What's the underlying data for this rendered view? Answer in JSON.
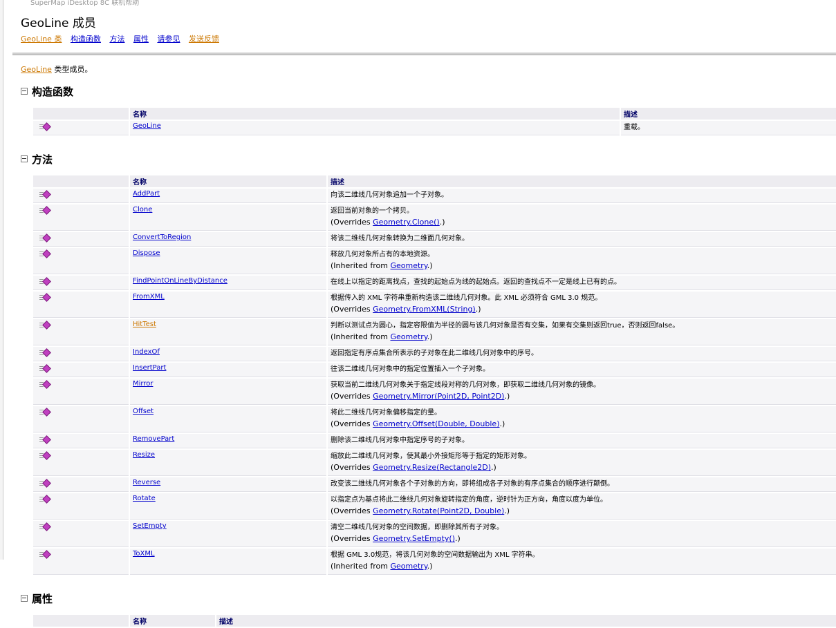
{
  "running_title": "SuperMap iDesktop 8C 联机帮助",
  "page_title": "GeoLine 成员",
  "nav": [
    {
      "label": "GeoLine 类",
      "style": "orange"
    },
    {
      "label": "构造函数",
      "style": "blue"
    },
    {
      "label": "方法",
      "style": "blue"
    },
    {
      "label": "属性",
      "style": "blue"
    },
    {
      "label": "请参见",
      "style": "blue"
    },
    {
      "label": "发送反馈",
      "style": "orange"
    }
  ],
  "intro": {
    "link": "GeoLine",
    "text": " 类型成员。"
  },
  "constructors": {
    "heading": "构造函数",
    "col_name": "名称",
    "col_desc": "描述",
    "rows": [
      {
        "icon": "method-icon",
        "name": "GeoLine",
        "desc": "重载。"
      }
    ]
  },
  "methods": {
    "heading": "方法",
    "col_name": "名称",
    "col_desc": "描述",
    "rows": [
      {
        "name": "AddPart",
        "desc": "向该二维线几何对象追加一个子对象。",
        "sub_prefix": "",
        "sub_link": "",
        "sub_suffix": ""
      },
      {
        "name": "Clone",
        "desc": "返回当前对象的一个拷贝。",
        "sub_prefix": "(Overrides ",
        "sub_link": "Geometry.Clone()",
        "sub_suffix": ".)"
      },
      {
        "name": "ConvertToRegion",
        "desc": "将该二维线几何对象转换为二维面几何对象。",
        "sub_prefix": "",
        "sub_link": "",
        "sub_suffix": ""
      },
      {
        "name": "Dispose",
        "desc": "释放几何对象所占有的本地资源。",
        "sub_prefix": "(Inherited from ",
        "sub_link": "Geometry",
        "sub_suffix": ".)"
      },
      {
        "name": "FindPointOnLineByDistance",
        "desc": "在线上以指定的距离找点，查找的起始点为线的起始点。返回的查找点不一定是线上已有的点。",
        "sub_prefix": "",
        "sub_link": "",
        "sub_suffix": ""
      },
      {
        "name": "FromXML",
        "desc": "根据传入的 XML 字符串重新构造该二维线几何对象。此 XML 必须符合 GML 3.0 规范。",
        "sub_prefix": "(Overrides ",
        "sub_link": "Geometry.FromXML(String)",
        "sub_suffix": ".)"
      },
      {
        "name": "HitTest",
        "orange": true,
        "desc": "判断以测试点为圆心，指定容限值为半径的圆与该几何对象是否有交集，如果有交集则返回true，否则返回false。",
        "sub_prefix": "(Inherited from ",
        "sub_link": "Geometry",
        "sub_suffix": ".)"
      },
      {
        "name": "IndexOf",
        "desc": "返回指定有序点集合所表示的子对象在此二维线几何对象中的序号。",
        "sub_prefix": "",
        "sub_link": "",
        "sub_suffix": ""
      },
      {
        "name": "InsertPart",
        "desc": "往该二维线几何对象中的指定位置插入一个子对象。",
        "sub_prefix": "",
        "sub_link": "",
        "sub_suffix": ""
      },
      {
        "name": "Mirror",
        "desc": "获取当前二维线几何对象关于指定线段对称的几何对象，即获取二维线几何对象的镜像。",
        "sub_prefix": "(Overrides ",
        "sub_link": "Geometry.Mirror(Point2D, Point2D)",
        "sub_suffix": ".)"
      },
      {
        "name": "Offset",
        "desc": "将此二维线几何对象偏移指定的量。",
        "sub_prefix": "(Overrides ",
        "sub_link": "Geometry.Offset(Double, Double)",
        "sub_suffix": ".)"
      },
      {
        "name": "RemovePart",
        "desc": "删除该二维线几何对象中指定序号的子对象。",
        "sub_prefix": "",
        "sub_link": "",
        "sub_suffix": ""
      },
      {
        "name": "Resize",
        "desc": "缩放此二维线几何对象，使其最小外接矩形等于指定的矩形对象。",
        "sub_prefix": "(Overrides ",
        "sub_link": "Geometry.Resize(Rectangle2D)",
        "sub_suffix": ".)"
      },
      {
        "name": "Reverse",
        "desc": "改变该二维线几何对象各个子对象的方向，即将组成各子对象的有序点集合的顺序进行颠倒。",
        "sub_prefix": "",
        "sub_link": "",
        "sub_suffix": ""
      },
      {
        "name": "Rotate",
        "desc": "以指定点为基点将此二维线几何对象旋转指定的角度，逆时针为正方向，角度以度为单位。",
        "sub_prefix": "(Overrides ",
        "sub_link": "Geometry.Rotate(Point2D, Double)",
        "sub_suffix": ".)"
      },
      {
        "name": "SetEmpty",
        "desc": "清空二维线几何对象的空间数据，即删除其所有子对象。",
        "sub_prefix": "(Overrides ",
        "sub_link": "Geometry.SetEmpty()",
        "sub_suffix": ".)"
      },
      {
        "name": "ToXML",
        "desc": "根据 GML 3.0规范，将该几何对象的空间数据输出为 XML 字符串。",
        "sub_prefix": "(Inherited from ",
        "sub_link": "Geometry",
        "sub_suffix": ".)"
      }
    ]
  },
  "properties": {
    "heading": "属性",
    "col_name": "名称",
    "col_desc": "描述"
  }
}
